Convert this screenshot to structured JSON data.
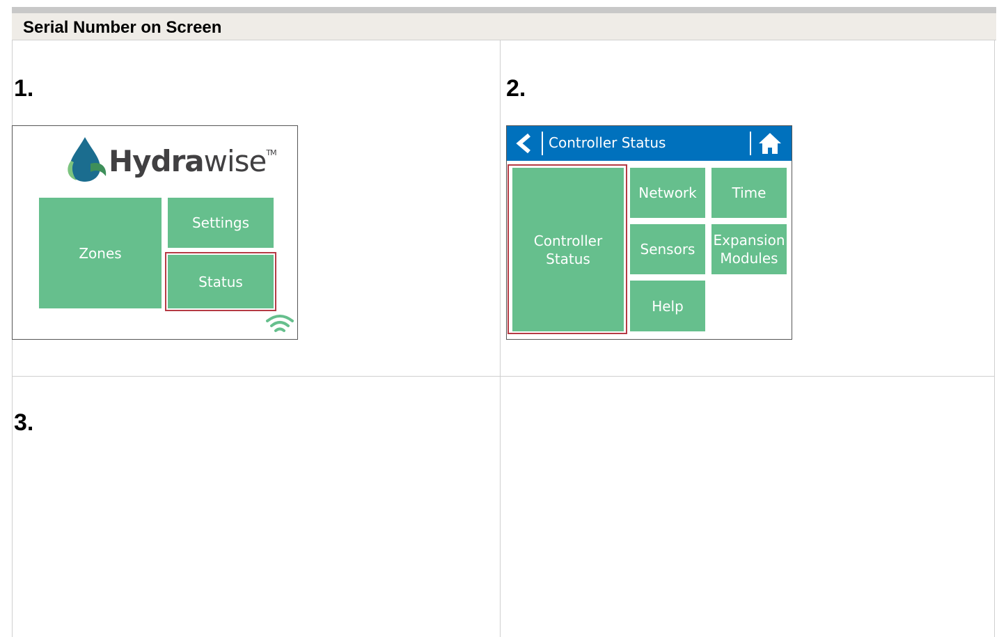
{
  "header": {
    "title": "Serial Number on Screen"
  },
  "steps": [
    "1.",
    "2.",
    "3."
  ],
  "screen1": {
    "logo_bold": "Hydra",
    "logo_light": "wise",
    "logo_tm": "TM",
    "tiles": {
      "zones": "Zones",
      "settings": "Settings",
      "status": "Status"
    }
  },
  "screen2": {
    "title": "Controller Status",
    "tiles": {
      "controller_status_line1": "Controller",
      "controller_status_line2": "Status",
      "network": "Network",
      "time": "Time",
      "sensors": "Sensors",
      "expansion_line1": "Expansion",
      "expansion_line2": "Modules",
      "help": "Help"
    }
  },
  "colors": {
    "tile": "#66bf8d",
    "header_blue": "#0071bd",
    "highlight": "#b53a44"
  }
}
